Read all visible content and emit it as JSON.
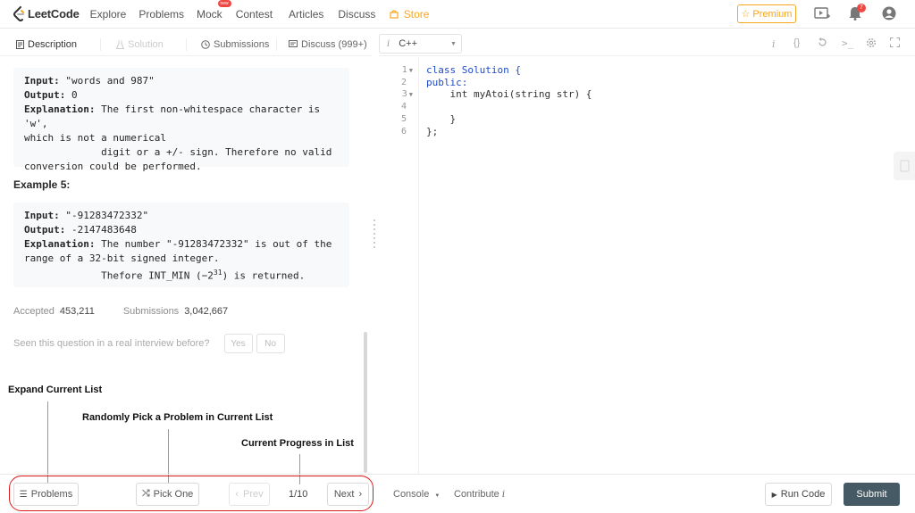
{
  "topnav": {
    "logo_text": "LeetCode",
    "items": [
      "Explore",
      "Problems",
      "Mock",
      "Contest",
      "Articles",
      "Discuss",
      "Store"
    ],
    "mock_badge": "new",
    "premium_label": "Premium",
    "notification_count": "7"
  },
  "left_tabs": {
    "description": "Description",
    "solution": "Solution",
    "submissions": "Submissions",
    "discuss": "Discuss (999+)"
  },
  "example4": {
    "input_label": "Input:",
    "input_value": " \"words and 987\"",
    "output_label": "Output:",
    "output_value": " 0",
    "explanation_label": "Explanation:",
    "line1": " The first non-whitespace character is 'w',",
    "line2": "which is not a numerical",
    "line3": "             digit or a +/- sign. Therefore no valid",
    "line4": "conversion could be performed."
  },
  "example5": {
    "title": "Example 5:",
    "input_label": "Input:",
    "input_value": " \"-91283472332\"",
    "output_label": "Output:",
    "output_value": " -2147483648",
    "explanation_label": "Explanation:",
    "line1": " The number \"-91283472332\" is out of the",
    "line2": "range of a 32-bit signed integer.",
    "line3_pre": "             Thefore INT_MIN (−2",
    "line3_sup": "31",
    "line3_post": ") is returned."
  },
  "stats": {
    "accepted_label": "Accepted",
    "accepted_value": "453,211",
    "submissions_label": "Submissions",
    "submissions_value": "3,042,667"
  },
  "interview": {
    "question": "Seen this question in a real interview before?",
    "yes": "Yes",
    "no": "No"
  },
  "annotations": {
    "expand": "Expand Current List",
    "random": "Randomly Pick a Problem in Current List",
    "progress": "Current Progress in List"
  },
  "editor": {
    "language": "C++",
    "line_numbers": [
      "1",
      "2",
      "3",
      "4",
      "5",
      "6"
    ],
    "lines": [
      "class Solution {",
      "public:",
      "    int myAtoi(string str) {",
      "",
      "    }",
      "};"
    ]
  },
  "bottom": {
    "problems": "Problems",
    "pick_one": "Pick One",
    "prev": "Prev",
    "progress": "1/10",
    "next": "Next",
    "console": "Console",
    "contribute": "Contribute",
    "run_code": "Run Code",
    "submit": "Submit"
  },
  "colors": {
    "accent_orange": "#f5a623",
    "submit_bg": "#455a64",
    "keyword_blue": "#1e4bc9",
    "annotation_red": "#e0171b"
  }
}
